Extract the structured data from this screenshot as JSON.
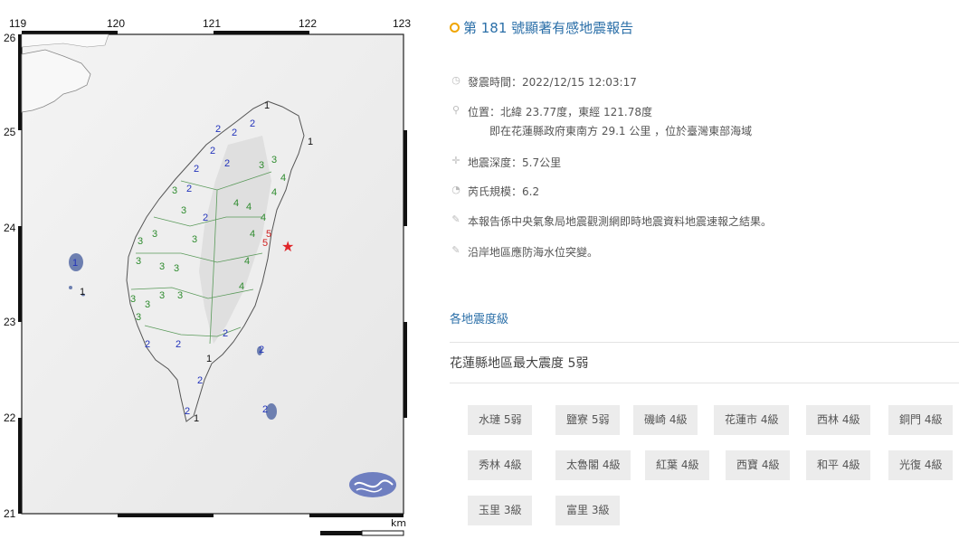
{
  "map": {
    "lon_labels": [
      "119",
      "120",
      "121",
      "122",
      "123"
    ],
    "lat_labels": [
      "26",
      "25",
      "24",
      "23",
      "22",
      "21"
    ],
    "scale_unit": "km",
    "epicenter_color": "#e0262a",
    "station_ints_north": [
      "1",
      "2",
      "2",
      "3",
      "2",
      "1",
      "2",
      "2",
      "3",
      "2",
      "3",
      "2",
      "1"
    ],
    "station_ints_west": [
      "3",
      "3",
      "3",
      "2",
      "2",
      "3",
      "3",
      "3",
      "3",
      "3",
      "2",
      "2",
      "1",
      "2"
    ],
    "station_ints_east": [
      "4",
      "4",
      "5",
      "4",
      "4",
      "4",
      "4",
      "4",
      "2",
      "2",
      "2"
    ]
  },
  "report": {
    "title": "第 181 號顯著有感地震報告",
    "time": "發震時間：2022/12/15 12:03:17",
    "location": "位置：北緯 23.77度，東經 121.78度",
    "location_detail": "即在花蓮縣政府東南方 29.1 公里 ，位於臺灣東部海域",
    "depth": "地震深度：5.7公里",
    "magnitude": "芮氏規模：6.2",
    "note1": "本報告係中央氣象局地震觀測網即時地震資料地震速報之結果。",
    "note2": "沿岸地區應防海水位突變。",
    "tab": "各地震度級",
    "max_intensity": "花蓮縣地區最大震度 5弱",
    "stations": [
      "水璉 5弱",
      "鹽寮 5弱",
      "磯崎 4級",
      "花蓮市 4級",
      "西林 4級",
      "銅門 4級",
      "秀林 4級",
      "太魯閣 4級",
      "紅葉 4級",
      "西寶 4級",
      "和平 4級",
      "光復 4級",
      "玉里 3級",
      "富里 3級"
    ]
  }
}
